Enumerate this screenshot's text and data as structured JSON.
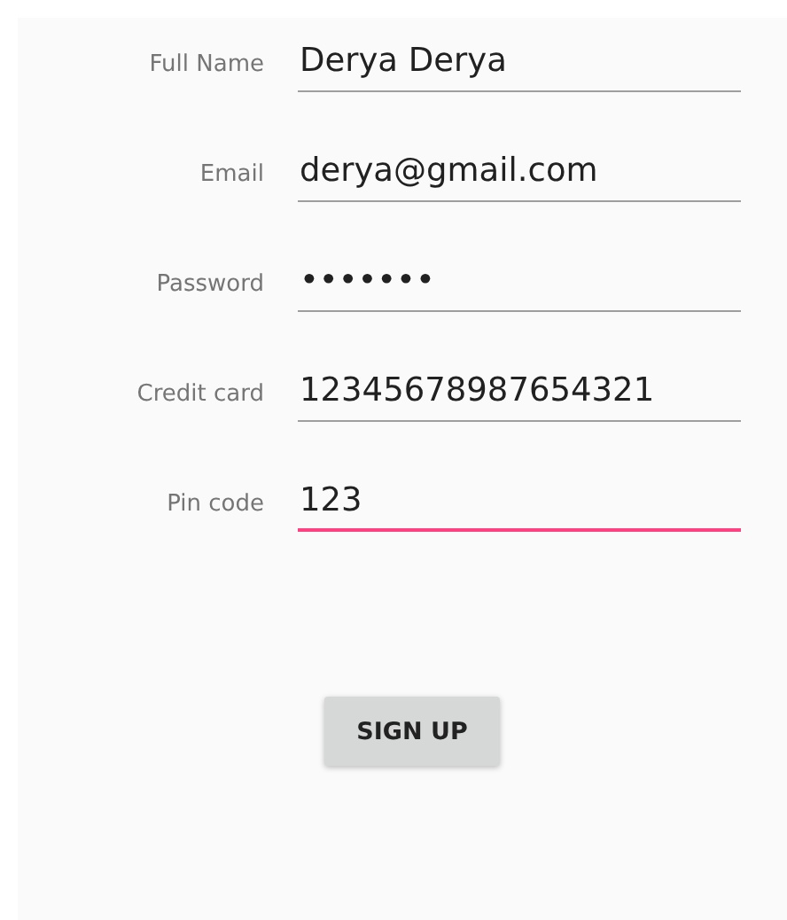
{
  "fields": [
    {
      "label": "Full Name",
      "value": "Derya Derya",
      "focused": false
    },
    {
      "label": "Email",
      "value": "derya@gmail.com",
      "focused": false
    },
    {
      "label": "Password",
      "value": "•••••••",
      "focused": false
    },
    {
      "label": "Credit card",
      "value": "12345678987654321",
      "focused": false
    },
    {
      "label": "Pin code",
      "value": "123",
      "focused": true
    }
  ],
  "button": "SIGN UP"
}
